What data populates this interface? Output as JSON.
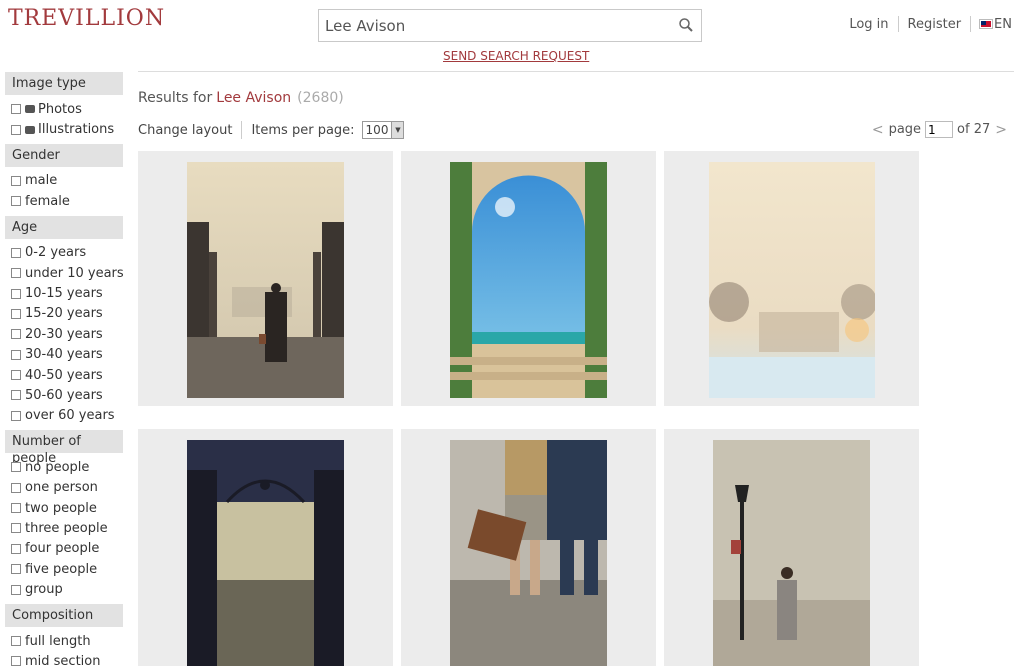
{
  "header": {
    "logo": "TREVILLION",
    "search_value": "Lee Avison",
    "send_request": "SEND SEARCH REQUEST",
    "login": "Log in",
    "register": "Register",
    "lang": "EN"
  },
  "sidebar": {
    "sections": [
      {
        "title": "Image type",
        "items": [
          "Photos",
          "Illustrations"
        ]
      },
      {
        "title": "Gender",
        "items": [
          "male",
          "female"
        ]
      },
      {
        "title": "Age",
        "items": [
          "0-2 years",
          "under 10 years",
          "10-15 years",
          "15-20 years",
          "20-30 years",
          "30-40 years",
          "40-50 years",
          "50-60 years",
          "over 60 years"
        ]
      },
      {
        "title": "Number of people",
        "items": [
          "no people",
          "one person",
          "two people",
          "three people",
          "four people",
          "five people",
          "group"
        ]
      },
      {
        "title": "Composition",
        "items": [
          "full length",
          "mid section"
        ]
      }
    ]
  },
  "results": {
    "label": "Results for",
    "term": "Lee Avison",
    "count": "(2680)"
  },
  "toolbar": {
    "change_layout": "Change layout",
    "items_per_page": "Items per page:",
    "per_page_value": "100"
  },
  "pager": {
    "page_label": "page",
    "page_value": "1",
    "of_label": "of 27"
  },
  "colors": {
    "brand": "#a23a3d",
    "sidebar_header": "#e2e2e2",
    "tile_bg": "#ececec"
  }
}
